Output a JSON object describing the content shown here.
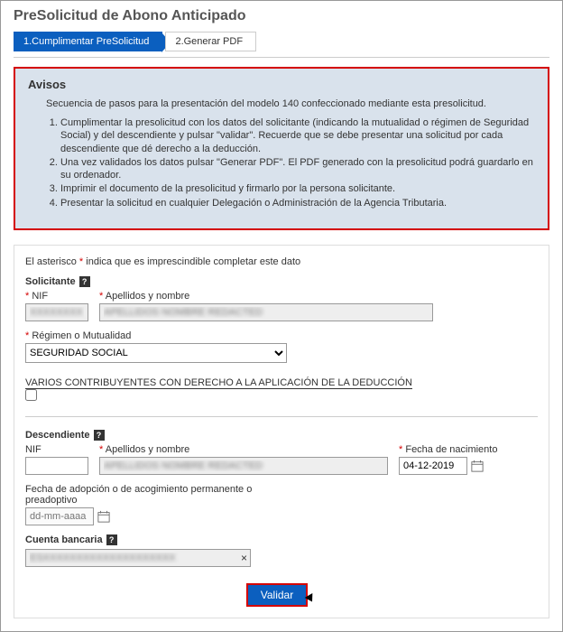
{
  "title": "PreSolicitud de Abono Anticipado",
  "steps": {
    "s1": "1.Cumplimentar PreSolicitud",
    "s2": "2.Generar PDF"
  },
  "avisos": {
    "heading": "Avisos",
    "sequence": "Secuencia de pasos para la presentación del modelo 140 confeccionado mediante esta presolicitud.",
    "items": [
      "Cumplimentar la presolicitud con los datos del solicitante (indicando la mutualidad o régimen de Seguridad Social) y del descendiente y pulsar \"validar\". Recuerde que se debe presentar una solicitud por cada descendiente que dé derecho a la deducción.",
      "Una vez validados los datos pulsar \"Generar PDF\". El PDF generado con la presolicitud podrá guardarlo en su ordenador.",
      "Imprimir el documento de la presolicitud y firmarlo por la persona solicitante.",
      "Presentar la solicitud en cualquier Delegación o Administración de la Agencia Tributaria."
    ]
  },
  "hint": {
    "pre": "El asterisco ",
    "post": " indica que es imprescindible completar este dato"
  },
  "solicitante": {
    "title": "Solicitante",
    "nif_label": "NIF",
    "nif_value": "XXXXXXXX",
    "name_label": "Apellidos y nombre",
    "name_value": "APELLIDOS NOMBRE REDACTED",
    "regimen_label": "Régimen o Mutualidad",
    "regimen_value": "SEGURIDAD SOCIAL",
    "varios_label": "VARIOS CONTRIBUYENTES CON DERECHO A LA APLICACIÓN DE LA DEDUCCIÓN"
  },
  "descendiente": {
    "title": "Descendiente",
    "nif_label": "NIF",
    "nif_value": "",
    "name_label": "Apellidos y nombre",
    "name_value": "APELLIDOS NOMBRE REDACTED",
    "fecha_nac_label": "Fecha de nacimiento",
    "fecha_nac_value": "04-12-2019",
    "fecha_adop_label": "Fecha de adopción o de acogimiento permanente o preadoptivo",
    "fecha_adop_placeholder": "dd-mm-aaaa"
  },
  "cuenta": {
    "title": "Cuenta bancaria",
    "value": "ESXXXXXXXXXXXXXXXXXXXX"
  },
  "buttons": {
    "validar": "Validar"
  }
}
